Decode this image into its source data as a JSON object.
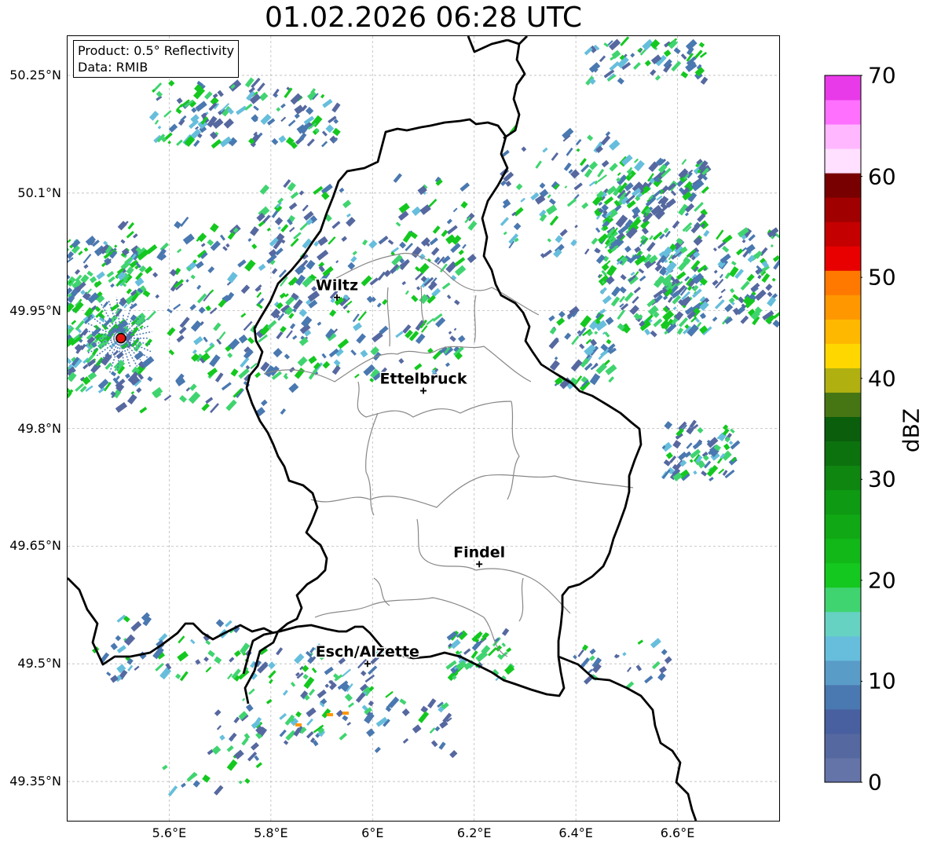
{
  "title": "01.02.2026 06:28 UTC",
  "info_box": {
    "product": "Product: 0.5° Reflectivity",
    "data_source": "Data: RMIB"
  },
  "map": {
    "lon_range": [
      5.4,
      6.8
    ],
    "lat_range": [
      49.3,
      50.3
    ],
    "lat_ticks": [
      {
        "value": 50.25,
        "label": "50.25°N"
      },
      {
        "value": 50.1,
        "label": "50.1°N"
      },
      {
        "value": 49.95,
        "label": "49.95°N"
      },
      {
        "value": 49.8,
        "label": "49.8°N"
      },
      {
        "value": 49.65,
        "label": "49.65°N"
      },
      {
        "value": 49.5,
        "label": "49.5°N"
      },
      {
        "value": 49.35,
        "label": "49.35°N"
      }
    ],
    "lon_ticks": [
      {
        "value": 5.6,
        "label": "5.6°E"
      },
      {
        "value": 5.8,
        "label": "5.8°E"
      },
      {
        "value": 6.0,
        "label": "6°E"
      },
      {
        "value": 6.2,
        "label": "6.2°E"
      },
      {
        "value": 6.4,
        "label": "6.4°E"
      },
      {
        "value": 6.6,
        "label": "6.6°E"
      }
    ],
    "grid": true,
    "cities": [
      {
        "name": "Wiltz",
        "lon": 5.93,
        "lat": 49.967
      },
      {
        "name": "Ettelbruck",
        "lon": 6.1,
        "lat": 49.848
      },
      {
        "name": "Findel",
        "lon": 6.21,
        "lat": 49.627
      },
      {
        "name": "Esch/Alzette",
        "lon": 5.99,
        "lat": 49.5
      }
    ],
    "radar_site": {
      "lon": 5.505,
      "lat": 49.915,
      "color": "#e8150f"
    }
  },
  "colorbar": {
    "unit_label": "dBZ",
    "min": 0,
    "max": 70,
    "tick_labels": [
      {
        "value": 0,
        "label": "0"
      },
      {
        "value": 10,
        "label": "10"
      },
      {
        "value": 20,
        "label": "20"
      },
      {
        "value": 30,
        "label": "30"
      },
      {
        "value": 40,
        "label": "40"
      },
      {
        "value": 50,
        "label": "50"
      },
      {
        "value": 60,
        "label": "60"
      },
      {
        "value": 70,
        "label": "70"
      }
    ],
    "colors": [
      "#6474a8",
      "#5668a0",
      "#4860a0",
      "#4a78b0",
      "#5a9cc8",
      "#66bedc",
      "#66d2c2",
      "#40d470",
      "#14c820",
      "#12b818",
      "#10a814",
      "#0e9a12",
      "#0e8610",
      "#0c720e",
      "#0a5e0c",
      "#467614",
      "#b0b010",
      "#ffd700",
      "#ffb800",
      "#ff9800",
      "#ff7800",
      "#e80000",
      "#c40000",
      "#a00000",
      "#780000",
      "#ffe0ff",
      "#ffb8ff",
      "#ff70ff",
      "#e83ae8"
    ]
  },
  "echo_colors": {
    "low": "#5668a0",
    "mid": "#4a78b0",
    "teal": "#66bedc",
    "green_light": "#40d470",
    "green": "#14c820",
    "orange": "#ff9800"
  }
}
